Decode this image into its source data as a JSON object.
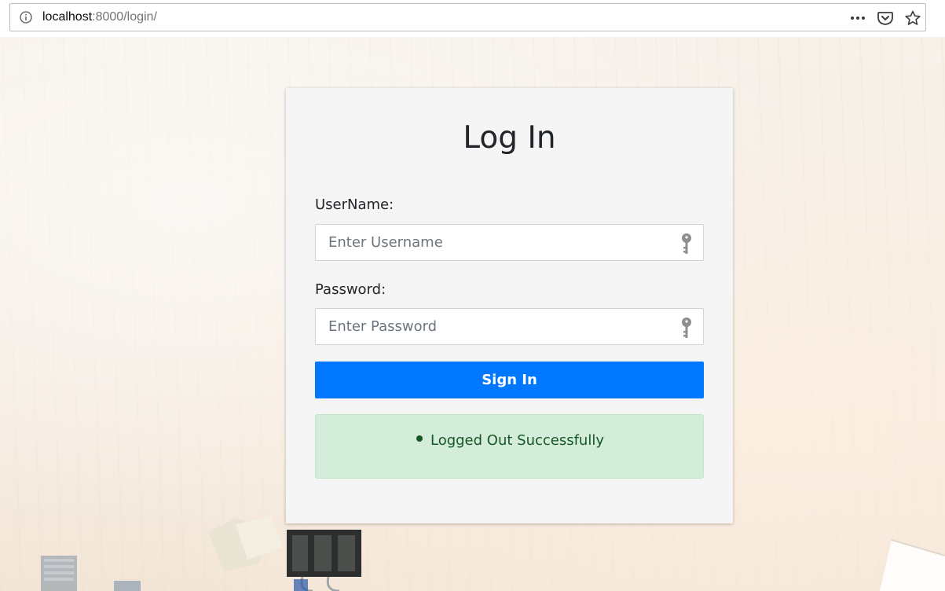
{
  "browser": {
    "url_host": "localhost",
    "url_rest": ":8000/login/",
    "icons": [
      "info-icon",
      "more-icon",
      "pocket-icon",
      "star-icon"
    ]
  },
  "login": {
    "title": "Log In",
    "username_label": "UserName:",
    "username_placeholder": "Enter Username",
    "username_value": "",
    "password_label": "Password:",
    "password_placeholder": "Enter Password",
    "password_value": "",
    "field_icon": "key-icon",
    "submit_label": "Sign In",
    "messages": [
      "Logged Out Successfully"
    ]
  },
  "colors": {
    "primary_button": "#0077ff",
    "success_bg": "#d4edda",
    "success_text": "#155724",
    "card_bg": "#f5f5f5"
  }
}
